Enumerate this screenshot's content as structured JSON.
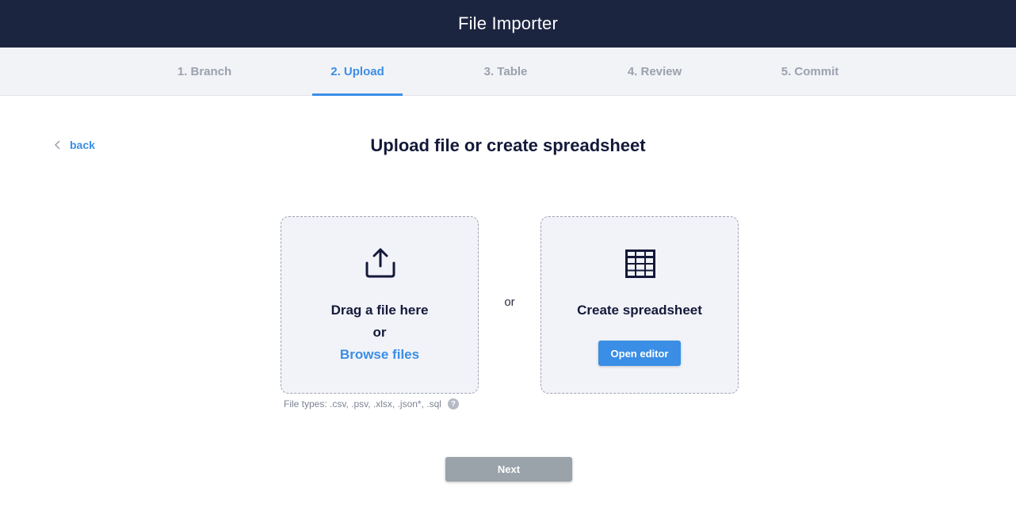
{
  "header": {
    "title": "File Importer"
  },
  "steps": [
    {
      "label": "1. Branch",
      "active": false
    },
    {
      "label": "2. Upload",
      "active": true
    },
    {
      "label": "3. Table",
      "active": false
    },
    {
      "label": "4. Review",
      "active": false
    },
    {
      "label": "5. Commit",
      "active": false
    }
  ],
  "back": {
    "label": "back"
  },
  "page_title": "Upload file or create spreadsheet",
  "upload_card": {
    "drag_text": "Drag a file here",
    "or_text": "or",
    "browse_label": "Browse files"
  },
  "or_between": "or",
  "sheet_card": {
    "title": "Create spreadsheet",
    "button_label": "Open editor"
  },
  "file_types": {
    "text": "File types: .csv, .psv, .xlsx, .json*, .sql",
    "help_icon": "?"
  },
  "next_label": "Next",
  "colors": {
    "header_bg": "#1c2540",
    "accent": "#3a8ee6",
    "disabled_button": "#9aa2aa"
  }
}
